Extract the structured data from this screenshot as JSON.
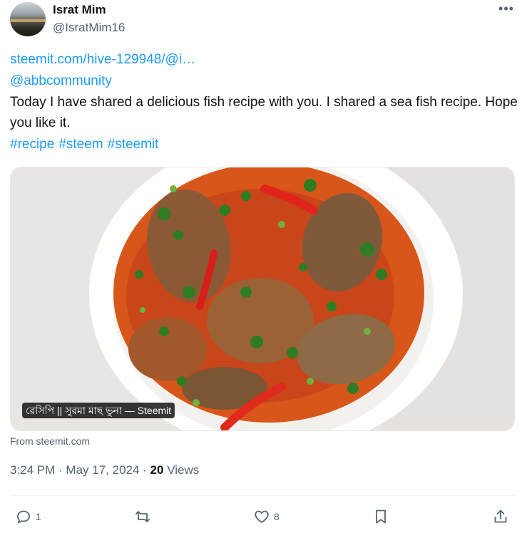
{
  "author": {
    "name": "Israt Mim",
    "handle": "@IsratMim16",
    "avatar_icon": "sunset-landscape-avatar"
  },
  "more_label": "•••",
  "tweet": {
    "link": "steemit.com/hive-129948/@i…",
    "mention": "@abbcommunity",
    "text": "Today I have shared a delicious fish recipe with you. I shared a sea fish recipe. Hope you like it.",
    "hashtags": [
      "#recipe",
      "#steem",
      "#steemit"
    ]
  },
  "card": {
    "image_icon": "fish-curry-photo",
    "label": "রেসিপি || সুরমা মাছ ভুনা — Steemit",
    "source": "From steemit.com"
  },
  "meta": {
    "time": "3:24 PM",
    "date": "May 17, 2024",
    "views_count": "20",
    "views_label": "Views"
  },
  "actions": {
    "replies": "1",
    "retweets": "",
    "likes": "8"
  },
  "colors": {
    "link": "#1d9bf0",
    "text": "#0f1419",
    "muted": "#536471"
  }
}
